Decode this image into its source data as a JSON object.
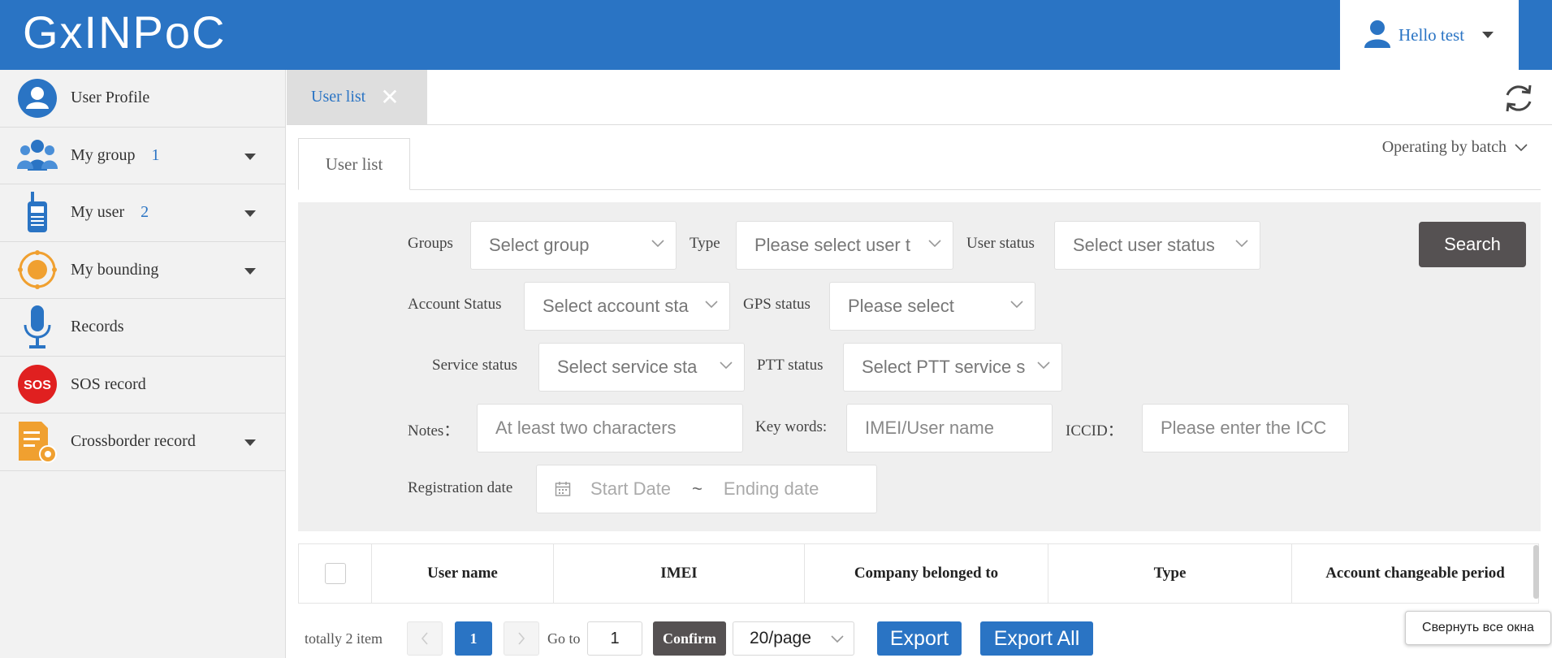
{
  "header": {
    "logo_text": "GxINPoC",
    "user_greeting": "Hello test",
    "brand_color": "#2a74c4"
  },
  "sidebar": {
    "items": [
      {
        "label": "User Profile",
        "icon": "user-profile-icon",
        "count": "",
        "dropdown": false
      },
      {
        "label": "My group",
        "icon": "group-icon",
        "count": "1",
        "dropdown": true
      },
      {
        "label": "My user",
        "icon": "walkie-talkie-icon",
        "count": "2",
        "dropdown": true
      },
      {
        "label": "My bounding",
        "icon": "location-target-icon",
        "count": "",
        "dropdown": true
      },
      {
        "label": "Records",
        "icon": "microphone-icon",
        "count": "",
        "dropdown": false
      },
      {
        "label": "SOS record",
        "icon": "sos-icon",
        "count": "",
        "dropdown": false
      },
      {
        "label": "Crossborder record",
        "icon": "document-gear-icon",
        "count": "",
        "dropdown": true
      }
    ]
  },
  "tabs": {
    "active_label": "User list",
    "close_glyph": "✕"
  },
  "content": {
    "subtab_label": "User list",
    "batch_label": "Operating by batch"
  },
  "filters": {
    "groups_label": "Groups",
    "groups_placeholder": "Select group",
    "type_label": "Type",
    "type_placeholder": "Please select user t",
    "user_status_label": "User status",
    "user_status_placeholder": "Select user status",
    "search_label": "Search",
    "account_status_label": "Account Status",
    "account_status_placeholder": "Select account sta",
    "gps_status_label": "GPS status",
    "gps_status_placeholder": "Please select",
    "service_status_label": "Service status",
    "service_status_placeholder": "Select service sta",
    "ptt_status_label": "PTT status",
    "ptt_status_placeholder": "Select PTT service s",
    "notes_label": "Notes：",
    "notes_placeholder": "At least two characters",
    "keywords_label": "Key words:",
    "keywords_placeholder": "IMEI/User name",
    "iccid_label": "ICCID：",
    "iccid_placeholder": "Please enter the ICC",
    "reg_date_label": "Registration date",
    "start_date_placeholder": "Start Date",
    "date_separator": "~",
    "end_date_placeholder": "Ending date"
  },
  "table": {
    "columns": [
      "User name",
      "IMEI",
      "Company belonged to",
      "Type",
      "Account changeable period"
    ]
  },
  "pagination": {
    "total_text": "totally 2 item",
    "current_page": "1",
    "goto_label": "Go to",
    "goto_value": "1",
    "confirm_label": "Confirm",
    "page_size": "20/page",
    "export_label": "Export",
    "export_all_label": "Export All"
  },
  "tooltip": {
    "text": "Свернуть все окна"
  }
}
